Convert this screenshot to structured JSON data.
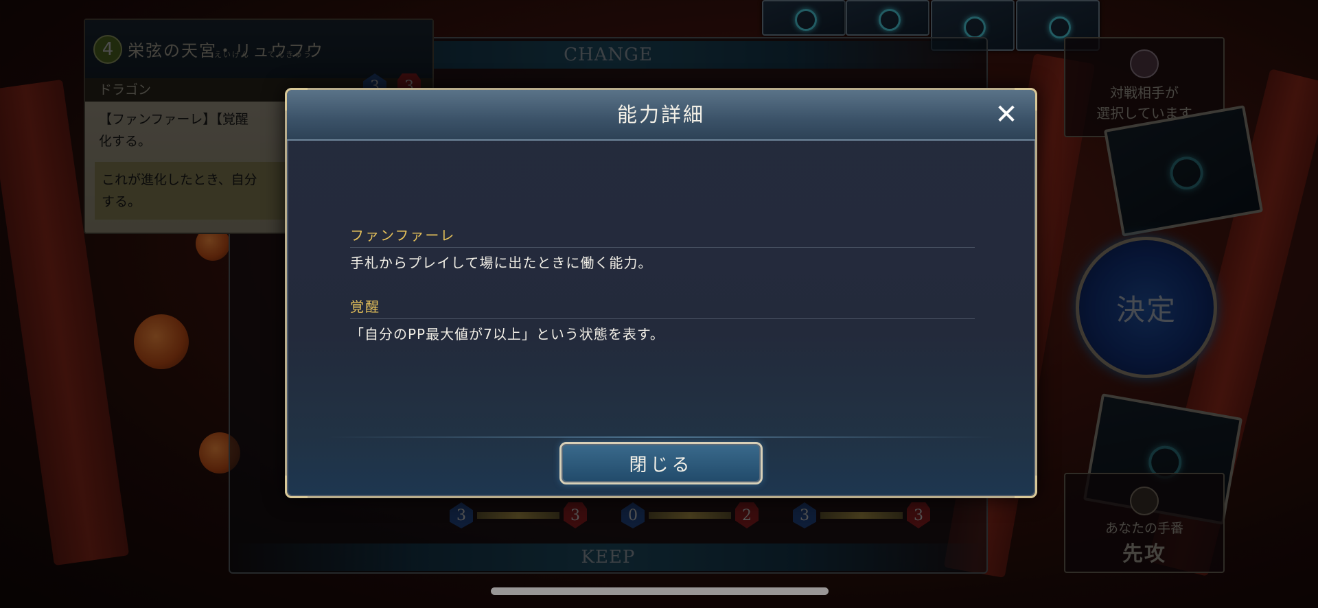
{
  "card_info": {
    "cost": "4",
    "name_ruby": "えいげん　　てんきゅう",
    "name": "栄弦の天宮・リュウフウ",
    "tribe": "ドラゴン",
    "text": "【ファンファーレ】【覚醒",
    "text_line2": "化する。",
    "evolve_text_line1": "これが進化したとき、自分",
    "evolve_text_line2": "する。",
    "attack": "3",
    "defense": "3"
  },
  "mulligan": {
    "top_label": "CHANGE",
    "bottom_label": "KEEP",
    "cards": [
      {
        "attack": "3",
        "defense": "3"
      },
      {
        "attack": "0",
        "defense": "2"
      },
      {
        "attack": "3",
        "defense": "3"
      }
    ]
  },
  "opponent_status": {
    "line1": "対戦相手が",
    "line2": "選択しています"
  },
  "decide_button": {
    "label": "決定"
  },
  "turn_info": {
    "label": "あなたの手番",
    "value": "先攻"
  },
  "modal": {
    "title": "能力詳細",
    "close_icon": "close-icon",
    "abilities": [
      {
        "term": "ファンファーレ",
        "description": "手札からプレイして場に出たときに働く能力。"
      },
      {
        "term": "覚醒",
        "description": "「自分のPP最大値が7以上」という状態を表す。"
      }
    ],
    "close_button_label": "閉じる"
  },
  "colors": {
    "accent_gold": "#e6c15a",
    "modal_bg": "#252b3d",
    "button_blue": "#2c5a7c"
  }
}
